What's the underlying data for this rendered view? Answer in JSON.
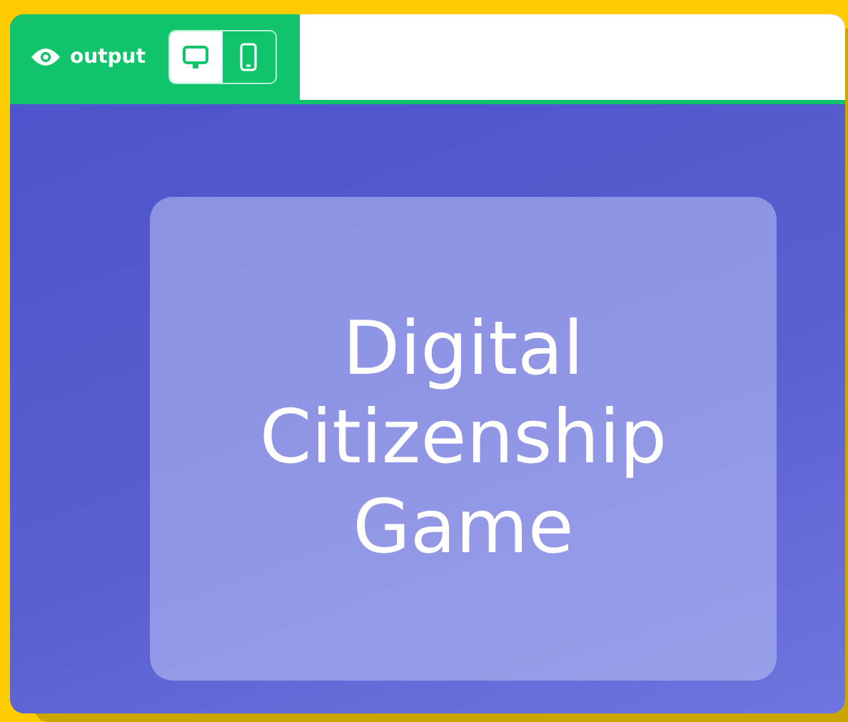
{
  "header": {
    "label": "output",
    "views": [
      {
        "kind": "desktop",
        "selected": true
      },
      {
        "kind": "mobile",
        "selected": false
      }
    ]
  },
  "card": {
    "title": "Digital Citizenship Game"
  }
}
